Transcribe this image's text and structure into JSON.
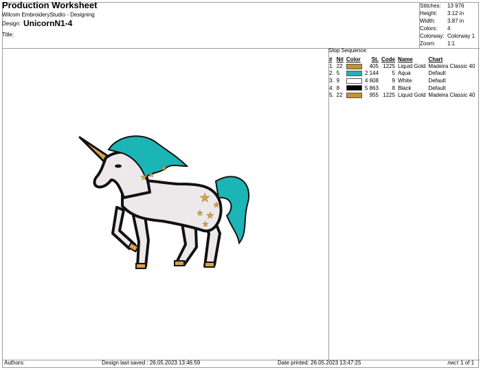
{
  "header": {
    "title": "Production Worksheet",
    "subtitle": "Wilcom EmbroideryStudio - Designing",
    "design_label": "Design:",
    "design_name": "UnicornN1-4",
    "title_label": "Title:"
  },
  "stats": [
    {
      "label": "Stitches:",
      "value": "13 976"
    },
    {
      "label": "Height:",
      "value": "3.12 in"
    },
    {
      "label": "Width:",
      "value": "3.87 in"
    },
    {
      "label": "Colors:",
      "value": "4"
    },
    {
      "label": "Colorway:",
      "value": "Colorway 1"
    },
    {
      "label": "Zoom:",
      "value": "1:1"
    }
  ],
  "stop_sequence": {
    "heading": "Stop Sequence:",
    "columns": [
      "#",
      "N#",
      "Color",
      "St.",
      "Code",
      "Name",
      "Chart"
    ],
    "rows": [
      {
        "index": "1.",
        "needle": "22",
        "color": "#C8912F",
        "stitches": "405",
        "code": "1225",
        "name": "Liquid Gold",
        "chart": "Madeira Classic 40"
      },
      {
        "index": "2.",
        "needle": "5",
        "color": "#1BB5B5",
        "stitches": "2 144",
        "code": "5",
        "name": "Aqua",
        "chart": "Default"
      },
      {
        "index": "3.",
        "needle": "9",
        "color": "#FFFFFF",
        "stitches": "4 608",
        "code": "9",
        "name": "White",
        "chart": "Default"
      },
      {
        "index": "4.",
        "needle": "8",
        "color": "#000000",
        "stitches": "5 863",
        "code": "8",
        "name": "Black",
        "chart": "Default"
      },
      {
        "index": "5.",
        "needle": "22",
        "color": "#C8912F",
        "stitches": "955",
        "code": "1225",
        "name": "Liquid Gold",
        "chart": "Madeira Classic 40"
      }
    ]
  },
  "footer": {
    "authors": "Authors:",
    "saved": "Design last saved : 26.05.2023 13:46:59",
    "printed": "Date printed: 26.05.2023 13:47:25",
    "page": "лист 1 of 1"
  },
  "design_preview": {
    "subject": "unicorn",
    "mane_color": "#1BB5B5",
    "body_color": "#EDE9EA",
    "outline_color": "#111111",
    "accent_color": "#D9A24A"
  }
}
